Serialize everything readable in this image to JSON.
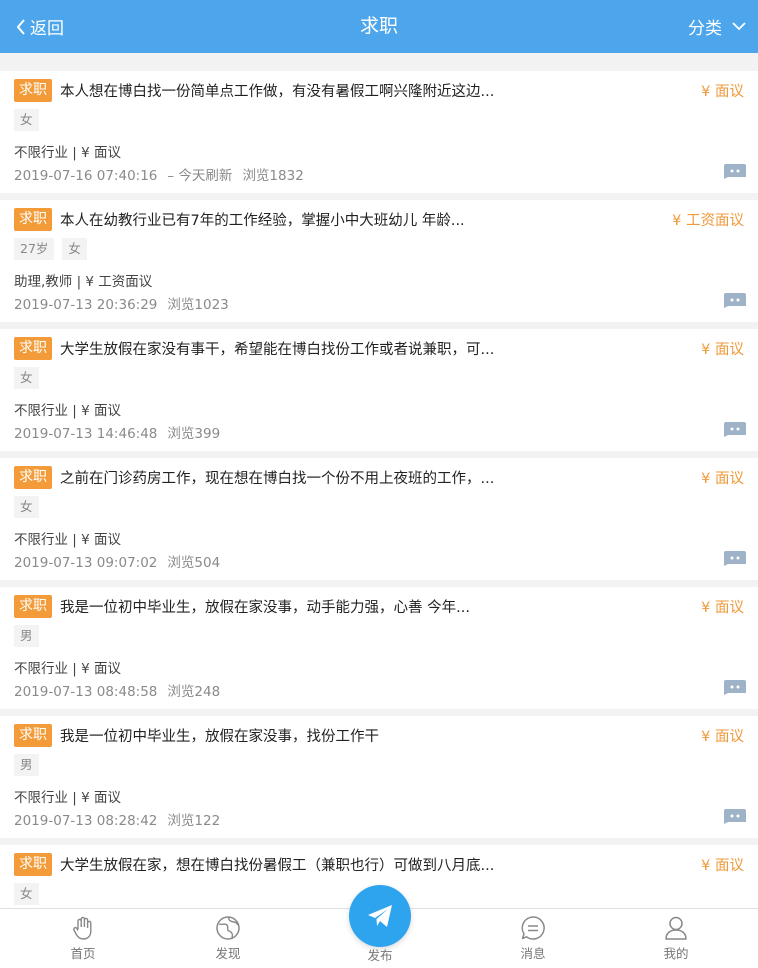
{
  "header": {
    "back_label": "返回",
    "title": "求职",
    "category_label": "分类"
  },
  "colors": {
    "header_bg": "#4da6ec",
    "tag_bg": "#f29b38",
    "salary": "#ef9a3b",
    "publish_bg": "#2ea3ee"
  },
  "listings": [
    {
      "tag": "求职",
      "description": "本人想在博白找一份简单点工作做，有没有暑假工啊兴隆附近这边...",
      "salary": "¥ 面议",
      "badges": [
        "女"
      ],
      "industry": "不限行业 | ¥ 面议",
      "datetime": "2019-07-16 07:40:16",
      "refresh": "– 今天刷新",
      "views": "浏览1832"
    },
    {
      "tag": "求职",
      "description": "本人在幼教行业已有7年的工作经验，掌握小中大班幼儿 年龄...",
      "salary": "¥ 工资面议",
      "badges": [
        "27岁",
        "女"
      ],
      "industry": "助理,教师 | ¥ 工资面议",
      "datetime": "2019-07-13 20:36:29",
      "refresh": "",
      "views": "浏览1023"
    },
    {
      "tag": "求职",
      "description": "大学生放假在家没有事干，希望能在博白找份工作或者说兼职，可...",
      "salary": "¥ 面议",
      "badges": [
        "女"
      ],
      "industry": "不限行业 | ¥ 面议",
      "datetime": "2019-07-13 14:46:48",
      "refresh": "",
      "views": "浏览399"
    },
    {
      "tag": "求职",
      "description": "之前在门诊药房工作，现在想在博白找一个份不用上夜班的工作，...",
      "salary": "¥ 面议",
      "badges": [
        "女"
      ],
      "industry": "不限行业 | ¥ 面议",
      "datetime": "2019-07-13 09:07:02",
      "refresh": "",
      "views": "浏览504"
    },
    {
      "tag": "求职",
      "description": "我是一位初中毕业生，放假在家没事，动手能力强，心善 今年...",
      "salary": "¥ 面议",
      "badges": [
        "男"
      ],
      "industry": "不限行业 | ¥ 面议",
      "datetime": "2019-07-13 08:48:58",
      "refresh": "",
      "views": "浏览248"
    },
    {
      "tag": "求职",
      "description": "我是一位初中毕业生，放假在家没事，找份工作干",
      "salary": "¥ 面议",
      "badges": [
        "男"
      ],
      "industry": "不限行业 | ¥ 面议",
      "datetime": "2019-07-13 08:28:42",
      "refresh": "",
      "views": "浏览122"
    },
    {
      "tag": "求职",
      "description": "大学生放假在家，想在博白找份暑假工（兼职也行）可做到八月底...",
      "salary": "¥ 面议",
      "badges": [
        "女"
      ],
      "industry": "",
      "datetime": "",
      "refresh": "",
      "views": ""
    }
  ],
  "tabbar": {
    "home": "首页",
    "discover": "发现",
    "publish": "发布",
    "messages": "消息",
    "mine": "我的"
  }
}
